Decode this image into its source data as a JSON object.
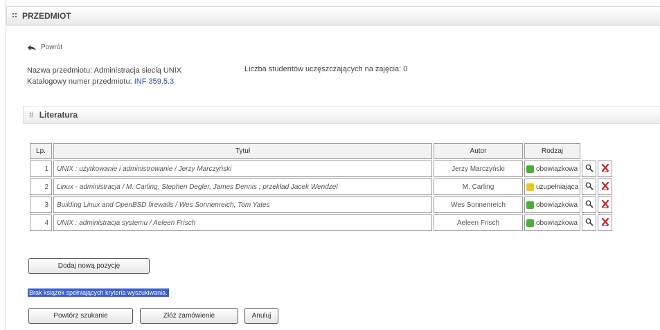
{
  "header": {
    "title": "PRZEDMIOT"
  },
  "back": {
    "label": "Powrót"
  },
  "info": {
    "course_name_label": "Nazwa przedmiotu:",
    "course_name": "Administracja siecią UNIX",
    "catalog_label": "Katalogowy numer przedmiotu:",
    "catalog_number": "INF 359.5.3",
    "students_label": "Liczba studentów uczęszczających na zajęcia:",
    "students_count": "0"
  },
  "literature": {
    "title": "Literatura",
    "columns": {
      "lp": "Lp.",
      "title": "Tytuł",
      "author": "Autor",
      "type": "Rodzaj"
    },
    "rows": [
      {
        "lp": "1",
        "title": "UNIX : użytkowanie i administrowanie / Jerzy Marczyński",
        "author": "Jerzy Marczyński",
        "type": "obowiązkowa",
        "type_color": "#4caf3a"
      },
      {
        "lp": "2",
        "title": "Linux - administracja / M. Carling, Stephen Degler, James Dennis ; przekład Jacek Wendzel",
        "author": "M. Carling",
        "type": "uzupełniająca",
        "type_color": "#e6c61f"
      },
      {
        "lp": "3",
        "title": "Building Linux and OpenBSD firewalls / Wes Sonnenreich, Tom Yates",
        "author": "Wes Sonnenreich",
        "type": "obowiązkowa",
        "type_color": "#4caf3a"
      },
      {
        "lp": "4",
        "title": "UNIX : administracja systemu / Aeleen Frisch",
        "author": "Aeleen Frisch",
        "type": "obowiązkowa",
        "type_color": "#4caf3a"
      }
    ]
  },
  "buttons": {
    "add_new": "Dodaj nową pozycję",
    "repeat_search": "Powtórz szukanie",
    "place_order": "Złóż zamówienie",
    "cancel": "Anuluj"
  },
  "message": "Brak książek spełniających kryteria wyszukiwania.",
  "icons": {
    "view": "magnifier-icon",
    "delete": "red-x-icon",
    "book": "book-icon"
  }
}
